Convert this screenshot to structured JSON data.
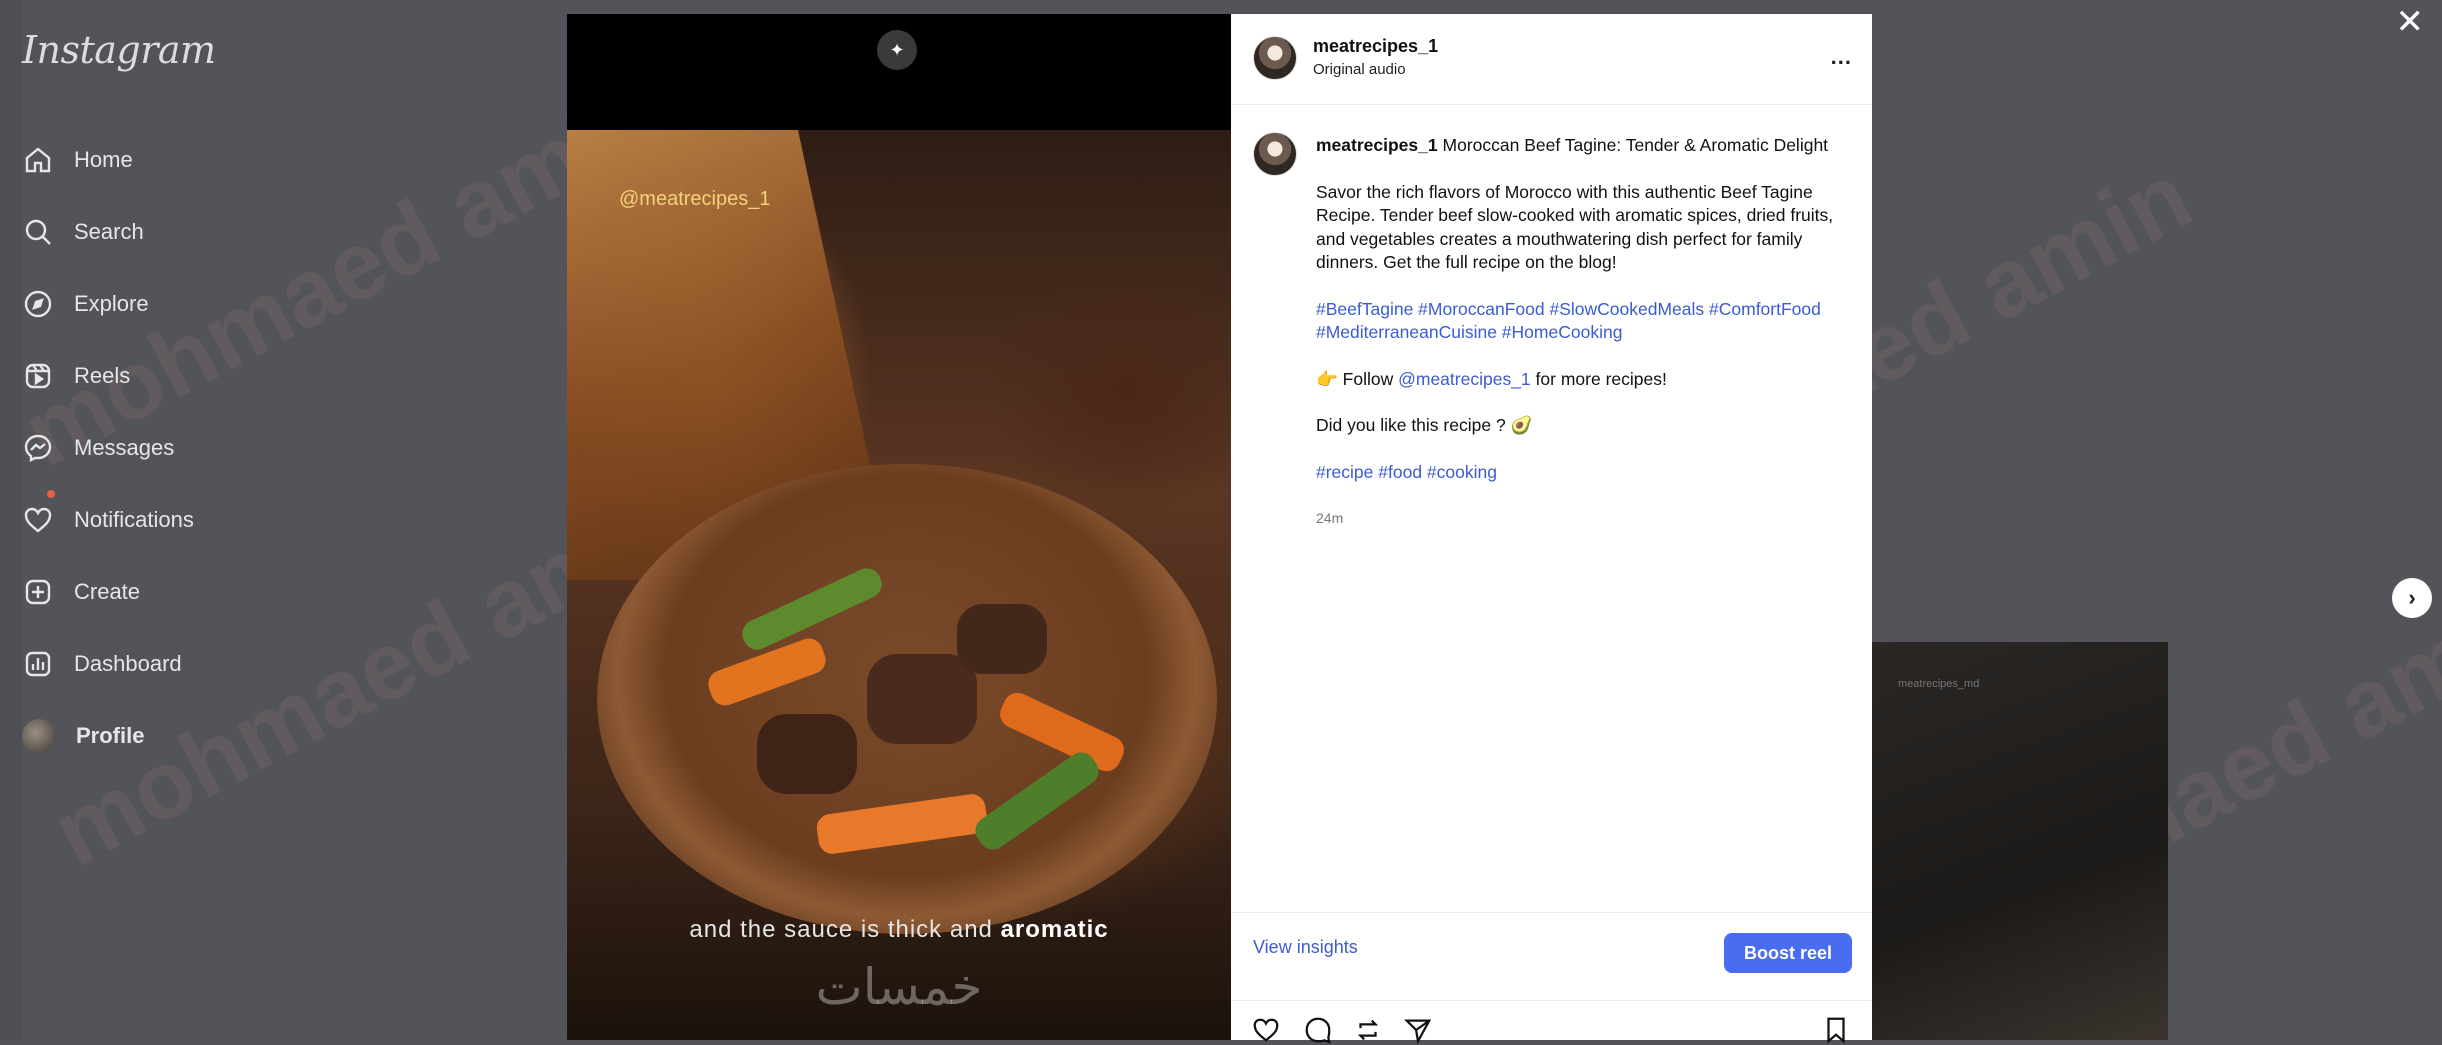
{
  "app": {
    "logo": "Instagram"
  },
  "sidebar": {
    "items": [
      {
        "label": "Home",
        "icon": "home-icon"
      },
      {
        "label": "Search",
        "icon": "search-icon"
      },
      {
        "label": "Explore",
        "icon": "compass-icon"
      },
      {
        "label": "Reels",
        "icon": "reels-icon"
      },
      {
        "label": "Messages",
        "icon": "messenger-icon"
      },
      {
        "label": "Notifications",
        "icon": "heart-icon"
      },
      {
        "label": "Create",
        "icon": "plus-square-icon"
      },
      {
        "label": "Dashboard",
        "icon": "dashboard-icon"
      },
      {
        "label": "Profile",
        "icon": "avatar"
      }
    ]
  },
  "watermark": "mohmaed amin",
  "media": {
    "handle": "@meatrecipes_1",
    "caption_prefix": "and the sauce is thick and",
    "caption_emphasis": "aromatic",
    "overlay_text": "خمسات"
  },
  "post": {
    "username": "meatrecipes_1",
    "audio": "Original audio",
    "more": "...",
    "title": "Moroccan Beef Tagine: Tender & Aromatic Delight",
    "description": "Savor the rich flavors of Morocco with this authentic Beef Tagine Recipe. Tender beef slow-cooked with aromatic spices, dried fruits, and vegetables creates a mouthwatering dish perfect for family dinners. Get the full recipe on the blog!",
    "hashtags1": "#BeefTagine #MoroccanFood #SlowCookedMeals #ComfortFood #MediterraneanCuisine #HomeCooking",
    "follow_prefix": "👉 Follow",
    "follow_handle": "@meatrecipes_1",
    "follow_suffix": "for more recipes!",
    "question": "Did you like this recipe ? 🥑",
    "hashtags2": "#recipe #food #cooking",
    "time": "24m",
    "view_insights": "View insights",
    "boost": "Boost reel"
  },
  "next_preview": {
    "label": "meatrecipes_md"
  },
  "controls": {
    "close": "✕",
    "next": "›"
  }
}
